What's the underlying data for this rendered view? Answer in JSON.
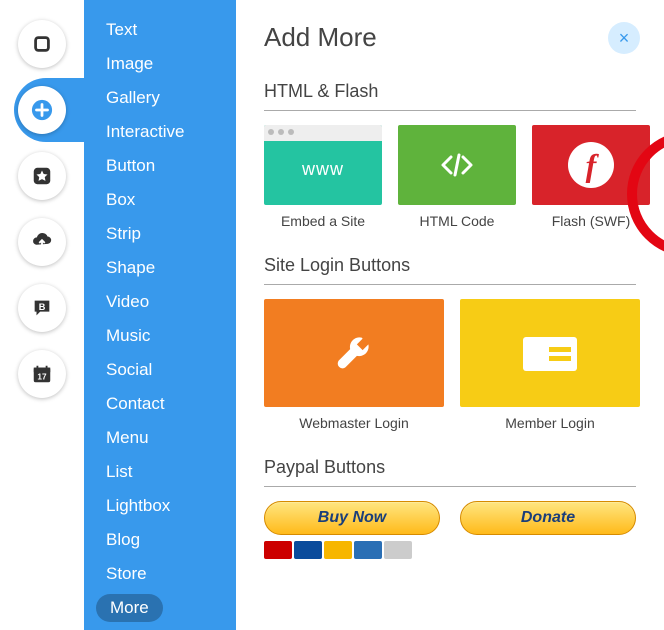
{
  "rail": {
    "items": [
      "stop",
      "add",
      "star",
      "upload",
      "bold",
      "calendar"
    ],
    "active_index": 1
  },
  "sidebar": {
    "items": [
      "Text",
      "Image",
      "Gallery",
      "Interactive",
      "Button",
      "Box",
      "Strip",
      "Shape",
      "Video",
      "Music",
      "Social",
      "Contact",
      "Menu",
      "List",
      "Lightbox",
      "Blog",
      "Store",
      "More"
    ],
    "selected": "More"
  },
  "main": {
    "title": "Add More",
    "close_label": "×"
  },
  "sections": {
    "html_flash": {
      "title": "HTML & Flash",
      "cards": {
        "embed": {
          "label": "Embed a Site",
          "text": "www"
        },
        "html": {
          "label": "HTML Code"
        },
        "flash": {
          "label": "Flash (SWF)"
        }
      }
    },
    "login_buttons": {
      "title": "Site Login Buttons",
      "cards": {
        "webmaster": {
          "label": "Webmaster Login"
        },
        "member": {
          "label": "Member Login"
        }
      }
    },
    "paypal": {
      "title": "Paypal Buttons",
      "buy_now": "Buy Now",
      "donate": "Donate"
    }
  },
  "colors": {
    "sidebar": "#3899ec",
    "embed": "#24c4a1",
    "html": "#5fb33c",
    "flash": "#d8232a",
    "wrench": "#f27d21",
    "member": "#f7cc15"
  }
}
